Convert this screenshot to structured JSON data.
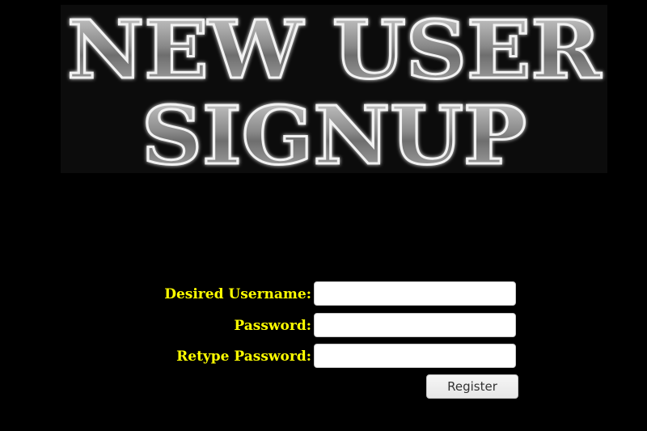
{
  "banner": {
    "line1": "NEW USER",
    "line2": "SIGNUP"
  },
  "form": {
    "username_label": "Desired Username:",
    "username_value": "",
    "password_label": "Password:",
    "password_value": "",
    "retype_label": "Retype Password:",
    "retype_value": "",
    "submit_label": "Register"
  },
  "colors": {
    "background": "#000000",
    "label": "#ffff00",
    "banner_text": "#9a9a9a"
  }
}
